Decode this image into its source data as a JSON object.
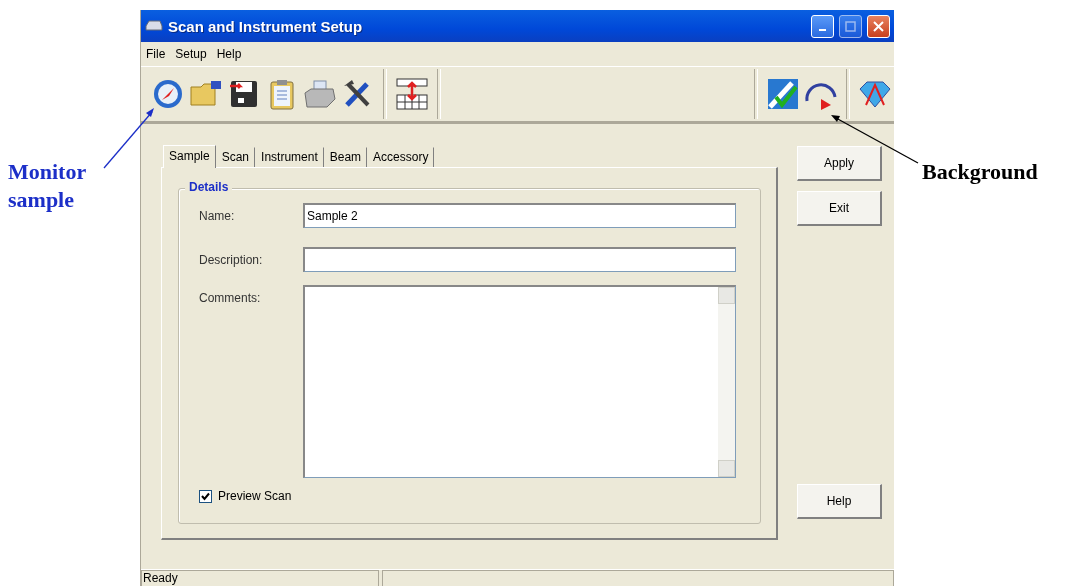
{
  "window": {
    "title": "Scan and Instrument Setup"
  },
  "menu": [
    "File",
    "Setup",
    "Help"
  ],
  "tabs": [
    {
      "label": "Sample",
      "selected": true
    },
    {
      "label": "Scan",
      "selected": false
    },
    {
      "label": "Instrument",
      "selected": false
    },
    {
      "label": "Beam",
      "selected": false
    },
    {
      "label": "Accessory",
      "selected": false
    }
  ],
  "details": {
    "title": "Details",
    "name": {
      "label": "Name:",
      "value": "Sample 2"
    },
    "description": {
      "label": "Description:"
    },
    "comments": {
      "label": "Comments:"
    },
    "preview_scan": {
      "label": "Preview Scan",
      "checked": true
    }
  },
  "buttons": {
    "apply": "Apply",
    "exit": "Exit",
    "help": "Help"
  },
  "status_bar": [
    "Ready"
  ],
  "annotations": {
    "left": "Monitor sample",
    "right": "Background"
  }
}
